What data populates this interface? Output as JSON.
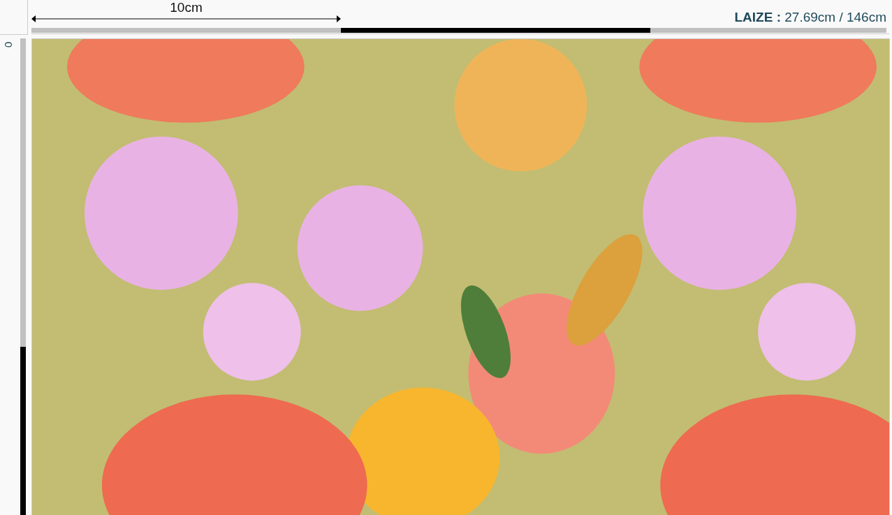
{
  "horizontal_ruler": {
    "label": "10cm"
  },
  "laize": {
    "label": "LAIZE :",
    "value": "27.69cm / 146cm"
  },
  "vertical_ruler": {
    "label": "0"
  }
}
